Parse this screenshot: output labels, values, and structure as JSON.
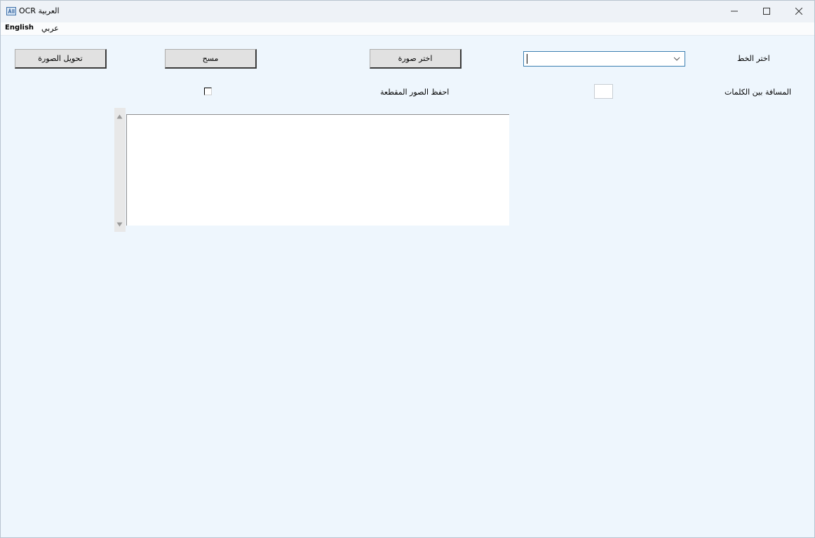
{
  "window": {
    "title": "OCR العربية",
    "icon": "app-icon",
    "controls": {
      "minimize": "—",
      "maximize": "☐",
      "close": "✕"
    }
  },
  "menu": {
    "english": "English",
    "arabic": "عربي"
  },
  "form": {
    "font_label": "اختر الخط",
    "font_select_value": "",
    "choose_image_label": "اختر صورة",
    "clear_label": "مسح",
    "convert_label": "تحويل الصورة",
    "word_spacing_label": "المسافة بين الكلمات",
    "word_spacing_value": "",
    "save_cropped_label": "احفظ الصور المقطعة",
    "save_cropped_checked": false,
    "output_text": ""
  },
  "colors": {
    "window_bg": "#eef6fd",
    "button_bg": "#e1e1e1",
    "focus_border": "#3c7fb1"
  }
}
